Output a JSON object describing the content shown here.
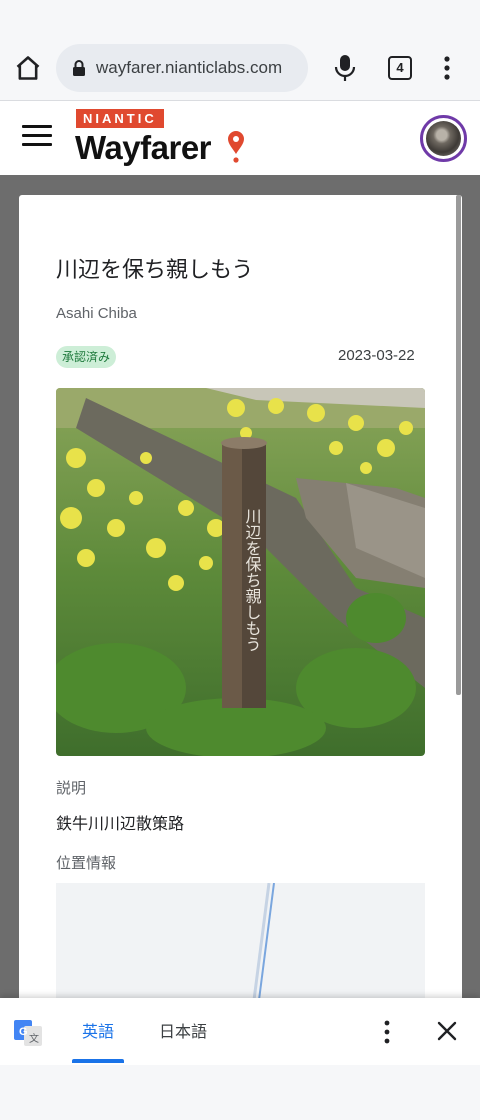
{
  "browser": {
    "url": "wayfarer.nianticlabs.com",
    "tab_count": "4",
    "icons": [
      "home-icon",
      "lock-icon",
      "mic-icon",
      "tab-switcher-icon",
      "more-vert-icon"
    ]
  },
  "site": {
    "brand_small": "NIANTIC",
    "brand_name": "Wayfarer",
    "brand_color": "#e0492f",
    "avatar_ring_color": "#6f3aa8"
  },
  "submission": {
    "title": "川辺を保ち親しもう",
    "author": "Asahi Chiba",
    "status": "承認済み",
    "status_color": "#cdeed7",
    "date": "2023-03-22",
    "post_text": "川辺を保ち親しもう",
    "description_label": "説明",
    "description": "鉄牛川川辺散策路",
    "location_label": "位置情報"
  },
  "translate_bar": {
    "tab_english": "英語",
    "tab_japanese": "日本語",
    "active_tab": "英語",
    "accent_color": "#1a73e8"
  }
}
